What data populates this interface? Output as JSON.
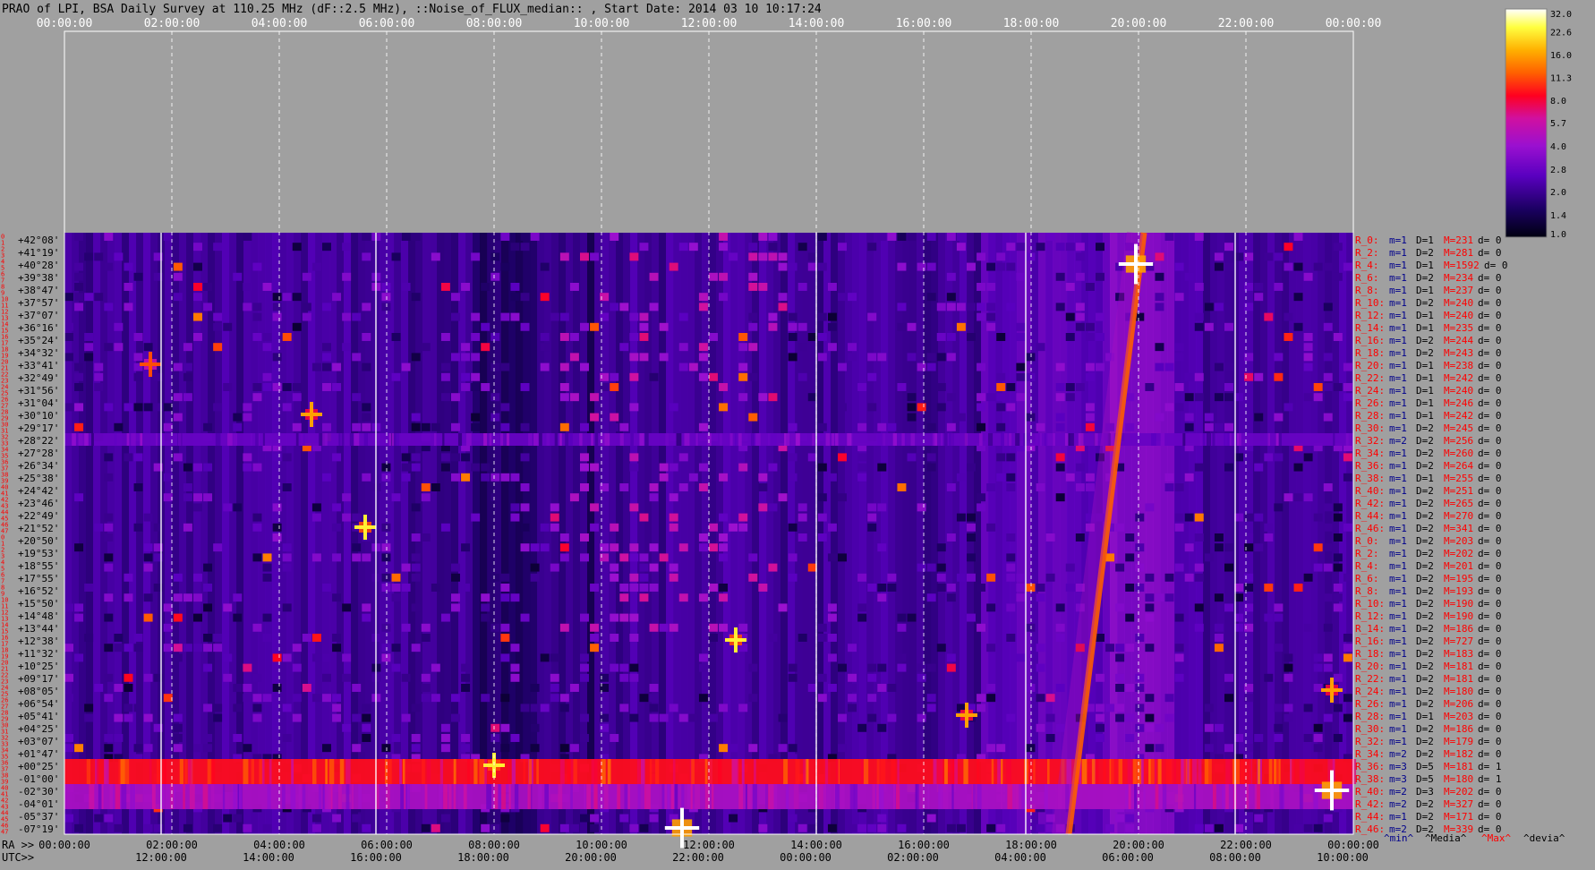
{
  "title": "PRAO of LPI, BSA Daily Survey at 110.25 MHz (dF::2.5 MHz), ::Noise_of_FLUX_median:: , Start Date: 2014 03 10 10:17:24",
  "colors": {
    "background": "#a0a0a0",
    "text": "#000000",
    "red_label": "#ff0000",
    "blue_label": "#00008b",
    "grid": "#ffffff"
  },
  "chart_data": {
    "type": "heatmap",
    "title": "PRAO of LPI, BSA Daily Survey at 110.25 MHz (dF::2.5 MHz), ::Noise_of_FLUX_median:: , Start Date: 2014 03 10 10:17:24",
    "x_top_ticks": [
      "00:00:00",
      "02:00:00",
      "04:00:00",
      "06:00:00",
      "08:00:00",
      "10:00:00",
      "12:00:00",
      "14:00:00",
      "16:00:00",
      "18:00:00",
      "20:00:00",
      "22:00:00",
      "00:00:00"
    ],
    "x_bottom_ra_label": "RA >>",
    "x_bottom_ra_ticks": [
      "00:00:00",
      "02:00:00",
      "04:00:00",
      "06:00:00",
      "08:00:00",
      "10:00:00",
      "12:00:00",
      "14:00:00",
      "16:00:00",
      "18:00:00",
      "20:00:00",
      "22:00:00",
      "00:00:00"
    ],
    "x_bottom_utc_label": "UTC>>",
    "x_bottom_utc_ticks": [
      "12:00:00",
      "14:00:00",
      "16:00:00",
      "18:00:00",
      "20:00:00",
      "22:00:00",
      "00:00:00",
      "02:00:00",
      "04:00:00",
      "06:00:00",
      "08:00:00",
      "10:00:00"
    ],
    "x_ra_range_hours": [
      0,
      24
    ],
    "y_dec_labels": [
      "+42°08'",
      "+41°19'",
      "+40°28'",
      "+39°38'",
      "+38°47'",
      "+37°57'",
      "+37°07'",
      "+36°16'",
      "+35°24'",
      "+34°32'",
      "+33°41'",
      "+32°49'",
      "+31°56'",
      "+31°04'",
      "+30°10'",
      "+29°17'",
      "+28°22'",
      "+27°28'",
      "+26°34'",
      "+25°38'",
      "+24°42'",
      "+23°46'",
      "+22°49'",
      "+21°52'",
      "+20°50'",
      "+19°53'",
      "+18°55'",
      "+17°55'",
      "+16°52'",
      "+15°50'",
      "+14°48'",
      "+13°44'",
      "+12°38'",
      "+11°32'",
      "+10°25'",
      "+09°17'",
      "+08°05'",
      "+06°54'",
      "+05°41'",
      "+04°25'",
      "+03°07'",
      "+01°47'",
      "+00°25'",
      "-01°00'",
      "-02°30'",
      "-04°01'",
      "-05°37'",
      "-07°19'"
    ],
    "y_row_numbers": [
      "0",
      "1",
      "2",
      "3",
      "4",
      "5",
      "6",
      "7",
      "8",
      "9",
      "10",
      "11",
      "12",
      "13",
      "14",
      "15",
      "16",
      "17",
      "18",
      "19",
      "20",
      "21",
      "22",
      "23",
      "24",
      "25",
      "26",
      "27",
      "28",
      "29",
      "30",
      "31",
      "32",
      "33",
      "34",
      "35",
      "36",
      "37",
      "38",
      "39",
      "40",
      "41",
      "42",
      "43",
      "44",
      "45",
      "46",
      "47",
      "0",
      "1",
      "2",
      "3",
      "4",
      "5",
      "6",
      "7",
      "8",
      "9",
      "10",
      "11",
      "12",
      "13",
      "14",
      "15",
      "16",
      "17",
      "18",
      "19",
      "20",
      "21",
      "22",
      "23",
      "24",
      "25",
      "26",
      "27",
      "28",
      "29",
      "30",
      "31",
      "32",
      "33",
      "34",
      "35",
      "36",
      "37",
      "38",
      "39",
      "40",
      "41",
      "42",
      "43",
      "44",
      "45",
      "46",
      "47"
    ],
    "stats_rows": [
      {
        "r": "R_0:",
        "m": "m=1",
        "d": "D=1",
        "max": "M=231",
        "dev": "d= 0"
      },
      {
        "r": "R_2:",
        "m": "m=1",
        "d": "D=2",
        "max": "M=281",
        "dev": "d= 0"
      },
      {
        "r": "R_4:",
        "m": "m=1",
        "d": "D=1",
        "max": "M=1592",
        "dev": "d= 0"
      },
      {
        "r": "R_6:",
        "m": "m=1",
        "d": "D=2",
        "max": "M=234",
        "dev": "d= 0"
      },
      {
        "r": "R_8:",
        "m": "m=1",
        "d": "D=1",
        "max": "M=237",
        "dev": "d= 0"
      },
      {
        "r": "R_10:",
        "m": "m=1",
        "d": "D=2",
        "max": "M=240",
        "dev": "d= 0"
      },
      {
        "r": "R_12:",
        "m": "m=1",
        "d": "D=1",
        "max": "M=240",
        "dev": "d= 0"
      },
      {
        "r": "R_14:",
        "m": "m=1",
        "d": "D=1",
        "max": "M=235",
        "dev": "d= 0"
      },
      {
        "r": "R_16:",
        "m": "m=1",
        "d": "D=2",
        "max": "M=244",
        "dev": "d= 0"
      },
      {
        "r": "R_18:",
        "m": "m=1",
        "d": "D=2",
        "max": "M=243",
        "dev": "d= 0"
      },
      {
        "r": "R_20:",
        "m": "m=1",
        "d": "D=1",
        "max": "M=238",
        "dev": "d= 0"
      },
      {
        "r": "R_22:",
        "m": "m=1",
        "d": "D=1",
        "max": "M=242",
        "dev": "d= 0"
      },
      {
        "r": "R_24:",
        "m": "m=1",
        "d": "D=1",
        "max": "M=240",
        "dev": "d= 0"
      },
      {
        "r": "R_26:",
        "m": "m=1",
        "d": "D=1",
        "max": "M=246",
        "dev": "d= 0"
      },
      {
        "r": "R_28:",
        "m": "m=1",
        "d": "D=1",
        "max": "M=242",
        "dev": "d= 0"
      },
      {
        "r": "R_30:",
        "m": "m=1",
        "d": "D=2",
        "max": "M=245",
        "dev": "d= 0"
      },
      {
        "r": "R_32:",
        "m": "m=2",
        "d": "D=2",
        "max": "M=256",
        "dev": "d= 0"
      },
      {
        "r": "R_34:",
        "m": "m=1",
        "d": "D=2",
        "max": "M=260",
        "dev": "d= 0"
      },
      {
        "r": "R_36:",
        "m": "m=1",
        "d": "D=2",
        "max": "M=264",
        "dev": "d= 0"
      },
      {
        "r": "R_38:",
        "m": "m=1",
        "d": "D=1",
        "max": "M=255",
        "dev": "d= 0"
      },
      {
        "r": "R_40:",
        "m": "m=1",
        "d": "D=2",
        "max": "M=251",
        "dev": "d= 0"
      },
      {
        "r": "R_42:",
        "m": "m=1",
        "d": "D=2",
        "max": "M=265",
        "dev": "d= 0"
      },
      {
        "r": "R_44:",
        "m": "m=1",
        "d": "D=2",
        "max": "M=270",
        "dev": "d= 0"
      },
      {
        "r": "R_46:",
        "m": "m=1",
        "d": "D=2",
        "max": "M=341",
        "dev": "d= 0"
      },
      {
        "r": "R_0:",
        "m": "m=1",
        "d": "D=2",
        "max": "M=203",
        "dev": "d= 0"
      },
      {
        "r": "R_2:",
        "m": "m=1",
        "d": "D=2",
        "max": "M=202",
        "dev": "d= 0"
      },
      {
        "r": "R_4:",
        "m": "m=1",
        "d": "D=2",
        "max": "M=201",
        "dev": "d= 0"
      },
      {
        "r": "R_6:",
        "m": "m=1",
        "d": "D=2",
        "max": "M=195",
        "dev": "d= 0"
      },
      {
        "r": "R_8:",
        "m": "m=1",
        "d": "D=2",
        "max": "M=193",
        "dev": "d= 0"
      },
      {
        "r": "R_10:",
        "m": "m=1",
        "d": "D=2",
        "max": "M=190",
        "dev": "d= 0"
      },
      {
        "r": "R_12:",
        "m": "m=1",
        "d": "D=2",
        "max": "M=190",
        "dev": "d= 0"
      },
      {
        "r": "R_14:",
        "m": "m=1",
        "d": "D=2",
        "max": "M=186",
        "dev": "d= 0"
      },
      {
        "r": "R_16:",
        "m": "m=1",
        "d": "D=2",
        "max": "M=727",
        "dev": "d= 0"
      },
      {
        "r": "R_18:",
        "m": "m=1",
        "d": "D=2",
        "max": "M=183",
        "dev": "d= 0"
      },
      {
        "r": "R_20:",
        "m": "m=1",
        "d": "D=2",
        "max": "M=181",
        "dev": "d= 0"
      },
      {
        "r": "R_22:",
        "m": "m=1",
        "d": "D=2",
        "max": "M=181",
        "dev": "d= 0"
      },
      {
        "r": "R_24:",
        "m": "m=1",
        "d": "D=2",
        "max": "M=180",
        "dev": "d= 0"
      },
      {
        "r": "R_26:",
        "m": "m=1",
        "d": "D=2",
        "max": "M=206",
        "dev": "d= 0"
      },
      {
        "r": "R_28:",
        "m": "m=1",
        "d": "D=1",
        "max": "M=203",
        "dev": "d= 0"
      },
      {
        "r": "R_30:",
        "m": "m=1",
        "d": "D=2",
        "max": "M=186",
        "dev": "d= 0"
      },
      {
        "r": "R_32:",
        "m": "m=1",
        "d": "D=2",
        "max": "M=179",
        "dev": "d= 0"
      },
      {
        "r": "R_34:",
        "m": "m=2",
        "d": "D=2",
        "max": "M=182",
        "dev": "d= 0"
      },
      {
        "r": "R_36:",
        "m": "m=3",
        "d": "D=5",
        "max": "M=181",
        "dev": "d= 1"
      },
      {
        "r": "R_38:",
        "m": "m=3",
        "d": "D=5",
        "max": "M=180",
        "dev": "d= 1"
      },
      {
        "r": "R_40:",
        "m": "m=2",
        "d": "D=3",
        "max": "M=202",
        "dev": "d= 0"
      },
      {
        "r": "R_42:",
        "m": "m=2",
        "d": "D=2",
        "max": "M=327",
        "dev": "d= 0"
      },
      {
        "r": "R_44:",
        "m": "m=1",
        "d": "D=2",
        "max": "M=171",
        "dev": "d= 0"
      },
      {
        "r": "R_46:",
        "m": "m=2",
        "d": "D=2",
        "max": "M=339",
        "dev": "d= 0"
      }
    ],
    "stats_legend": [
      "^min^",
      "^Media^",
      "^Max^",
      "^devia^"
    ],
    "colorbar_ticks": [
      "32.0",
      "22.6",
      "16.0",
      "11.3",
      "8.0",
      "5.7",
      "4.0",
      "2.8",
      "2.0",
      "1.4",
      "1.0"
    ],
    "colorbar_range": [
      1.0,
      32.0
    ],
    "colorbar_scale": "log",
    "vertical_grid_hours": [
      0,
      2,
      4,
      6,
      8,
      10,
      12,
      14,
      16,
      18,
      20,
      22,
      24
    ],
    "features": [
      {
        "kind": "horizontal_band",
        "dec_rows": [
          42,
          43
        ],
        "level": 9.0
      },
      {
        "kind": "horizontal_band",
        "dec_rows": [
          44,
          45
        ],
        "level": 4.5
      },
      {
        "kind": "horizontal_band",
        "dec_rows": [
          16
        ],
        "level": 2.8
      },
      {
        "kind": "diagonal_track",
        "ra_hours": [
          18.7,
          20.1
        ],
        "dec_rows": [
          47,
          0
        ],
        "level": 12.0
      },
      {
        "kind": "point_source",
        "ra_hours": 19.95,
        "dec_row": 2,
        "level": 32.0
      },
      {
        "kind": "point_source",
        "ra_hours": 11.5,
        "dec_row": 47,
        "level": 32.0
      },
      {
        "kind": "point_source",
        "ra_hours": 23.6,
        "dec_row": 44,
        "level": 32.0
      },
      {
        "kind": "point_source",
        "ra_hours": 12.5,
        "dec_row": 32,
        "level": 22.6
      },
      {
        "kind": "point_source",
        "ra_hours": 5.6,
        "dec_row": 23,
        "level": 22.6
      },
      {
        "kind": "point_source",
        "ra_hours": 8.0,
        "dec_row": 42,
        "level": 22.6
      },
      {
        "kind": "point_source",
        "ra_hours": 4.6,
        "dec_row": 14,
        "level": 16.0
      },
      {
        "kind": "point_source",
        "ra_hours": 16.8,
        "dec_row": 38,
        "level": 16.0
      },
      {
        "kind": "point_source",
        "ra_hours": 1.6,
        "dec_row": 10,
        "level": 11.3
      },
      {
        "kind": "point_source",
        "ra_hours": 23.6,
        "dec_row": 36,
        "level": 16.0
      },
      {
        "kind": "white_column",
        "ra_hours": [
          1.8,
          5.8,
          14.0,
          17.9,
          21.8
        ]
      }
    ]
  }
}
